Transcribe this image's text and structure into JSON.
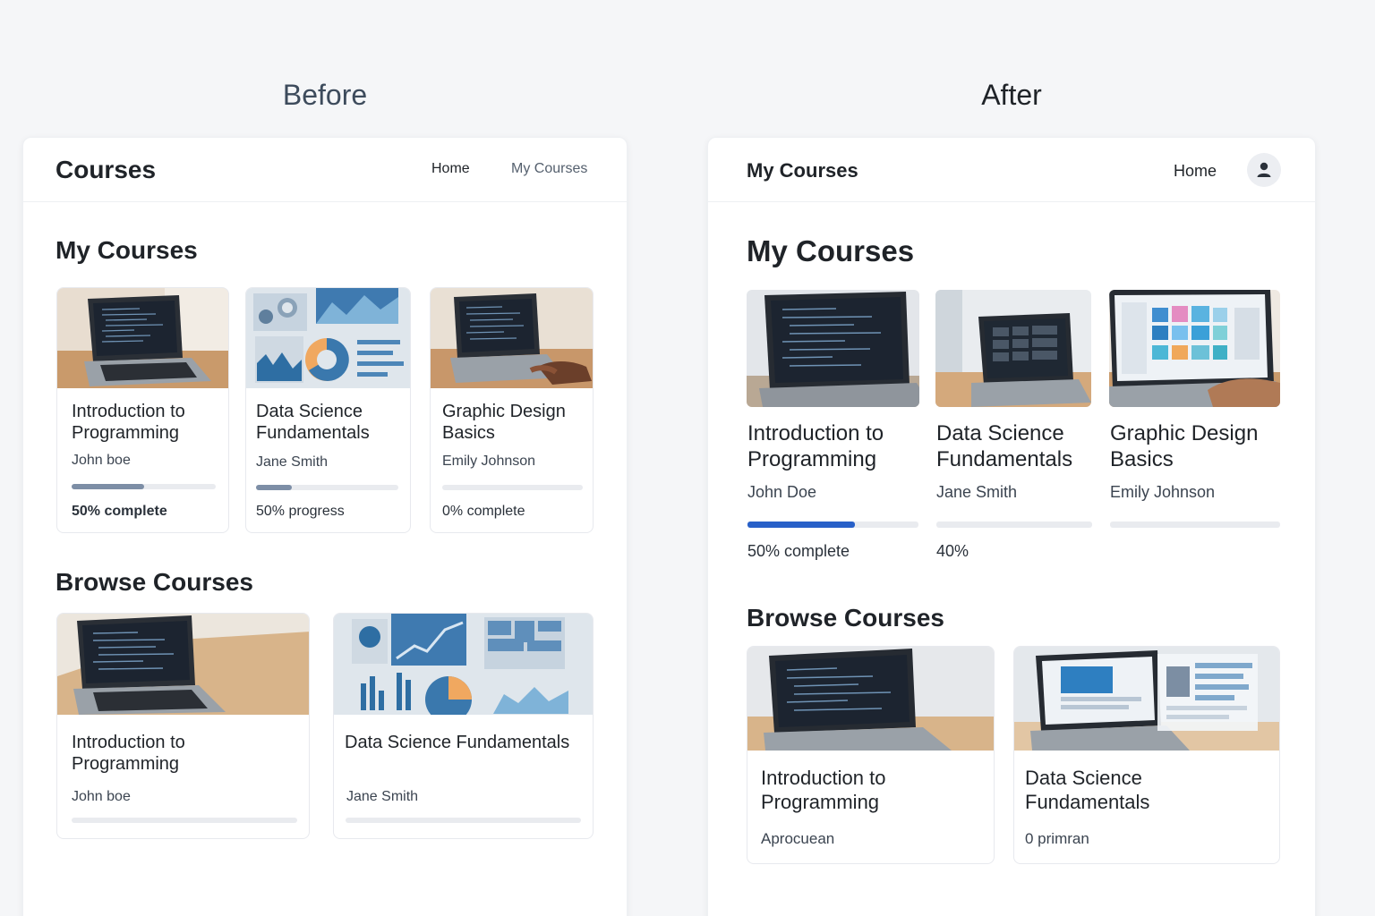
{
  "labels": {
    "before": "Before",
    "after": "After"
  },
  "colors": {
    "progress_before": "#7d8ea6",
    "progress_after": "#2860c8",
    "track": "#e9ebef"
  },
  "before": {
    "brand": "Courses",
    "nav": {
      "home": "Home",
      "my_courses": "My Courses"
    },
    "my_courses_heading": "My Courses",
    "browse_heading": "Browse Courses",
    "my_courses": [
      {
        "title": "Introduction to Programming",
        "instructor": "John boe",
        "progress": 0.5,
        "progress_text": "50% complete",
        "image": "laptop-code"
      },
      {
        "title": "Data Science Fundamentals",
        "instructor": "Jane Smith",
        "progress": 0.25,
        "progress_text": "50% progress",
        "image": "data-charts"
      },
      {
        "title": "Graphic Design Basics",
        "instructor": "Emily Johnson",
        "progress": 0,
        "progress_text": "0% complete",
        "image": "laptop-hands"
      }
    ],
    "browse": [
      {
        "title": "Introduction to Programming",
        "instructor": "John boe",
        "image": "laptop-code"
      },
      {
        "title": "Data Science Fundamentals",
        "instructor": "Jane Smith",
        "image": "data-charts"
      }
    ]
  },
  "after": {
    "brand": "My Courses",
    "nav": {
      "home": "Home",
      "avatar_icon": "user-icon"
    },
    "my_courses_heading": "My Courses",
    "browse_heading": "Browse Courses",
    "my_courses": [
      {
        "title": "Introduction to Programming",
        "instructor": "John Doe",
        "progress": 0.63,
        "progress_text": "50% complete",
        "image": "laptop-code"
      },
      {
        "title": "Data Science Fundamentals",
        "instructor": "Jane Smith",
        "progress": 0,
        "progress_text": "40%",
        "image": "laptop-grid"
      },
      {
        "title": "Graphic Design Basics",
        "instructor": "Emily Johnson",
        "progress": 0,
        "progress_text": "",
        "image": "laptop-design"
      }
    ],
    "browse": [
      {
        "title": "Introduction to Programming",
        "subtitle": "Aprocuean",
        "image": "laptop-code"
      },
      {
        "title": "Data Science Fundamentals",
        "subtitle": "0 primran",
        "image": "laptop-dashboard"
      }
    ]
  }
}
